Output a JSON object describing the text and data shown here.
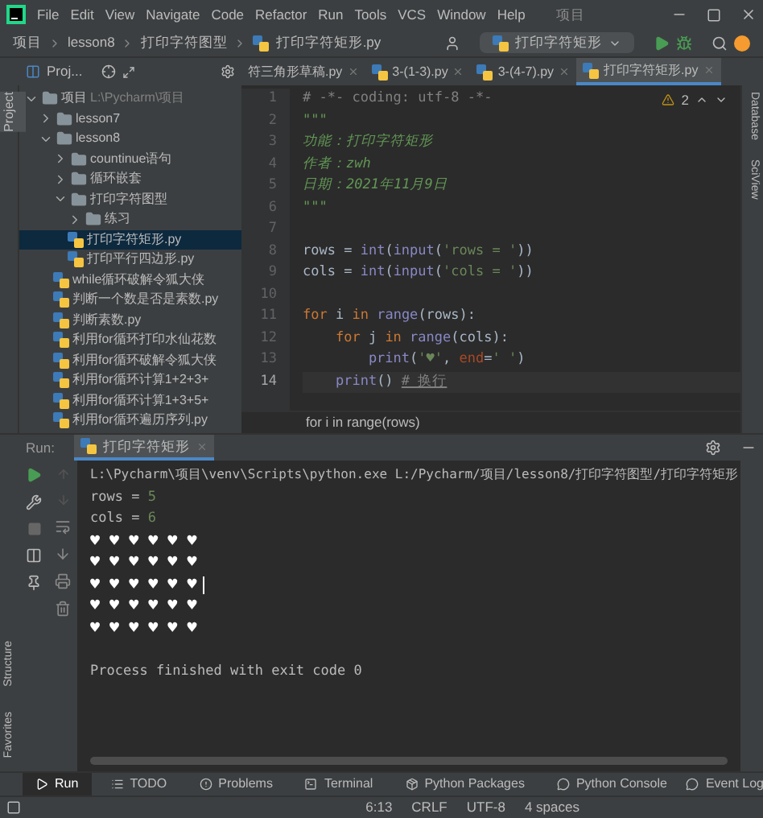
{
  "menu_bar": {
    "items": [
      "File",
      "Edit",
      "View",
      "Navigate",
      "Code",
      "Refactor",
      "Run",
      "Tools",
      "VCS",
      "Window",
      "Help"
    ],
    "title": "项目"
  },
  "nav_bar": {
    "breadcrumbs": [
      "项目",
      "lesson8",
      "打印字符图型",
      "打印字符矩形.py"
    ],
    "run_config": "打印字符矩形"
  },
  "project_panel": {
    "title": "Proj..."
  },
  "editor_tabs": [
    {
      "label": "符三角形草稿.py",
      "selected": false
    },
    {
      "label": "3-(1-3).py",
      "selected": false
    },
    {
      "label": "3-(4-7).py",
      "selected": false
    },
    {
      "label": "打印字符矩形.py",
      "selected": true
    }
  ],
  "left_strip": [
    "Project",
    "Structure",
    "Favorites"
  ],
  "right_strip": [
    "Database",
    "SciView"
  ],
  "tree": [
    {
      "label": "项目",
      "hint": "L:\\Pycharm\\项目",
      "kind": "folder",
      "expanded": true,
      "selected": false,
      "children": [
        {
          "label": "lesson7",
          "kind": "folder",
          "expanded": false,
          "selected": false
        },
        {
          "label": "lesson8",
          "kind": "folder",
          "expanded": true,
          "selected": false,
          "children": [
            {
              "label": "countinue语句",
              "kind": "folder",
              "expanded": false,
              "selected": false
            },
            {
              "label": "循环嵌套",
              "kind": "folder",
              "expanded": false,
              "selected": false
            },
            {
              "label": "打印字符图型",
              "kind": "folder",
              "expanded": true,
              "selected": false,
              "children": [
                {
                  "label": "练习",
                  "kind": "folder",
                  "expanded": false,
                  "selected": false
                },
                {
                  "label": "打印字符矩形.py",
                  "kind": "file",
                  "selected": true
                },
                {
                  "label": "打印平行四边形.py",
                  "kind": "file",
                  "selected": false
                }
              ]
            },
            {
              "label": "while循环破解令狐大侠",
              "kind": "file",
              "selected": false
            },
            {
              "label": "判断一个数是否是素数.py",
              "kind": "file",
              "selected": false
            },
            {
              "label": "判断素数.py",
              "kind": "file",
              "selected": false
            },
            {
              "label": "利用for循环打印水仙花数",
              "kind": "file",
              "selected": false
            },
            {
              "label": "利用for循环破解令狐大侠",
              "kind": "file",
              "selected": false
            },
            {
              "label": "利用for循环计算1+2+3+",
              "kind": "file",
              "selected": false
            },
            {
              "label": "利用for循环计算1+3+5+",
              "kind": "file",
              "selected": false
            },
            {
              "label": "利用for循环遍历序列.py",
              "kind": "file",
              "selected": false
            }
          ]
        }
      ]
    }
  ],
  "editor": {
    "warnings": "2",
    "breadcrumb": "for i in range(rows)",
    "lines": [
      {
        "number": "1",
        "tokens": [
          {
            "kind": "comment",
            "text": "# -*- coding: utf-8 -*-"
          }
        ]
      },
      {
        "number": "2",
        "tokens": [
          {
            "kind": "doc",
            "text": "\"\"\""
          }
        ]
      },
      {
        "number": "3",
        "tokens": [
          {
            "kind": "doc",
            "text": "功能：打印字符矩形"
          }
        ]
      },
      {
        "number": "4",
        "tokens": [
          {
            "kind": "doc",
            "text": "作者：zwh"
          }
        ]
      },
      {
        "number": "5",
        "tokens": [
          {
            "kind": "doc",
            "text": "日期：2021年11月9日"
          }
        ]
      },
      {
        "number": "6",
        "tokens": [
          {
            "kind": "doc",
            "text": "\"\"\""
          }
        ]
      },
      {
        "number": "7"
      },
      {
        "number": "8",
        "tokens": [
          {
            "kind": "plain",
            "text": "rows = "
          },
          {
            "kind": "builtin",
            "text": "int"
          },
          {
            "kind": "plain",
            "text": "("
          },
          {
            "kind": "builtin",
            "text": "input"
          },
          {
            "kind": "plain",
            "text": "("
          },
          {
            "kind": "string",
            "text": "'rows = '"
          },
          {
            "kind": "plain",
            "text": "))"
          }
        ]
      },
      {
        "number": "9",
        "tokens": [
          {
            "kind": "plain",
            "text": "cols = "
          },
          {
            "kind": "builtin",
            "text": "int"
          },
          {
            "kind": "plain",
            "text": "("
          },
          {
            "kind": "builtin",
            "text": "input"
          },
          {
            "kind": "plain",
            "text": "("
          },
          {
            "kind": "string",
            "text": "'cols = '"
          },
          {
            "kind": "plain",
            "text": "))"
          }
        ]
      },
      {
        "number": "10"
      },
      {
        "number": "11",
        "tokens": [
          {
            "kind": "keyword",
            "text": "for"
          },
          {
            "kind": "plain",
            "text": " i "
          },
          {
            "kind": "keyword",
            "text": "in"
          },
          {
            "kind": "builtin",
            "text": " range"
          },
          {
            "kind": "plain",
            "text": "(rows):"
          }
        ]
      },
      {
        "number": "12",
        "tokens": [
          {
            "kind": "keyword",
            "text": "    for"
          },
          {
            "kind": "plain",
            "text": " j "
          },
          {
            "kind": "keyword",
            "text": "in"
          },
          {
            "kind": "builtin",
            "text": " range"
          },
          {
            "kind": "plain",
            "text": "(cols):"
          }
        ]
      },
      {
        "number": "13",
        "tokens": [
          {
            "kind": "builtin",
            "text": "        print"
          },
          {
            "kind": "plain",
            "text": "("
          },
          {
            "kind": "string",
            "text": "'♥'"
          },
          {
            "kind": "plain",
            "text": ", "
          },
          {
            "kind": "param",
            "text": "end"
          },
          {
            "kind": "plain",
            "text": "="
          },
          {
            "kind": "string",
            "text": "' '"
          },
          {
            "kind": "plain",
            "text": ")"
          }
        ]
      },
      {
        "number": "14",
        "current": true,
        "tokens": [
          {
            "kind": "builtin",
            "text": "    print"
          },
          {
            "kind": "plain",
            "text": "() "
          },
          {
            "kind": "comment",
            "text": "# 换行"
          }
        ]
      }
    ]
  },
  "run_panel": {
    "label": "Run:",
    "tab": "打印字符矩形",
    "output": [
      {
        "kind": "path",
        "text": "L:\\Pycharm\\项目\\venv\\Scripts\\python.exe L:/Pycharm/项目/lesson8/打印字符图型/打印字符矩形"
      },
      {
        "kind": "prompt",
        "text": "rows = ",
        "value": "5"
      },
      {
        "kind": "prompt",
        "text": "cols = ",
        "value": "6"
      },
      {
        "kind": "hearts",
        "text": "♥ ♥ ♥ ♥ ♥ ♥",
        "cursor": false
      },
      {
        "kind": "hearts",
        "text": "♥ ♥ ♥ ♥ ♥ ♥",
        "cursor": false
      },
      {
        "kind": "hearts",
        "text": "♥ ♥ ♥ ♥ ♥ ♥",
        "cursor": true
      },
      {
        "kind": "hearts",
        "text": "♥ ♥ ♥ ♥ ♥ ♥",
        "cursor": false
      },
      {
        "kind": "hearts",
        "text": "♥ ♥ ♥ ♥ ♥ ♥",
        "cursor": false
      },
      {
        "kind": "exit",
        "text": "Process finished with exit code 0"
      }
    ]
  },
  "tool_tabs": [
    {
      "label": "Run",
      "kind": "run",
      "selected": true
    },
    {
      "label": "TODO",
      "kind": "todo",
      "selected": false
    },
    {
      "label": "Problems",
      "kind": "problems",
      "selected": false
    },
    {
      "label": "Terminal",
      "kind": "terminal",
      "selected": false
    },
    {
      "label": "Python Packages",
      "kind": "packages",
      "selected": false
    },
    {
      "label": "Python Console",
      "kind": "console",
      "selected": false
    }
  ],
  "event_log": "Event Log",
  "status_bar": [
    "6:13",
    "CRLF",
    "UTF-8",
    "4 spaces"
  ]
}
